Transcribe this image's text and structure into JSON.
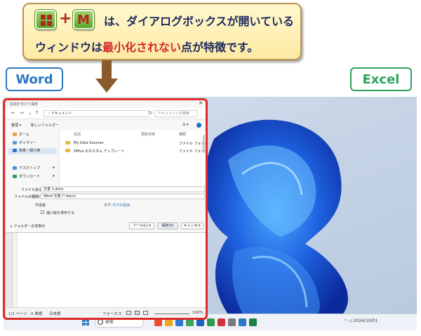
{
  "callout": {
    "key1_icon": "windows-logo-key",
    "plus": "+",
    "key2": "M",
    "line1": "は、ダイアログボックスが開いている",
    "line2_pre": "ウィンドウは",
    "line2_red": "最小化されない",
    "line2_post": "点が特徴です。",
    "colors": {
      "accent_red": "#d3262d",
      "text_navy": "#1c2a5e",
      "key_green": "#58a82e"
    }
  },
  "labels": {
    "word": "Word",
    "excel": "Excel"
  },
  "dialog": {
    "title": "名前を付けて保存",
    "close": "✕",
    "address": "› ドキュメント",
    "search_placeholder": "ドキュメントの検索",
    "toolbar": {
      "organize": "整理 ▾",
      "new_folder": "新しいフォルダー",
      "view": "☰ ▾"
    },
    "sidebar": {
      "home": "ホーム",
      "gallery": "ギャラリー",
      "selected": "未来・個人用",
      "desktop": "デスクトップ",
      "downloads": "ダウンロード",
      "pin": "✱"
    },
    "columns": {
      "name": "名前",
      "date": "更新日時",
      "type": "種類"
    },
    "files": [
      {
        "name": "My Data Sources",
        "type": "ファイル フォルダー"
      },
      {
        "name": "Office のカスタム テンプレート",
        "type": "ファイル フォルダー"
      }
    ],
    "filename_label": "ファイル名(N):",
    "filename_value": "文書 1.docx",
    "filetype_label": "ファイルの種類(T):",
    "filetype_value": "Word 文書 (*.docx)",
    "author_label": "作成者:",
    "tag_label": "タグ:",
    "tag_value": "タグの追加",
    "thumbnail_label": "縮小版を保存する",
    "hide_folders": "∧ フォルダーの非表示",
    "tools_button": "ツール(L) ▾",
    "save_button": "保存(S)",
    "cancel_button": "キャンセル"
  },
  "word_status": {
    "page": "1/1 ページ",
    "words": "0 単語",
    "language": "日本語",
    "focus": "フォーカス",
    "zoom": "100%"
  },
  "taskbar": {
    "search_placeholder": "検索",
    "time": "2024/10/01",
    "icon_colors": [
      "#e94d2d",
      "#f2a31b",
      "#2e7ad1",
      "#3aa55b",
      "#1f5fbf",
      "#2b9a4a",
      "#d13438",
      "#7a7a7a",
      "#2b78c2",
      "#1e7e45"
    ]
  }
}
